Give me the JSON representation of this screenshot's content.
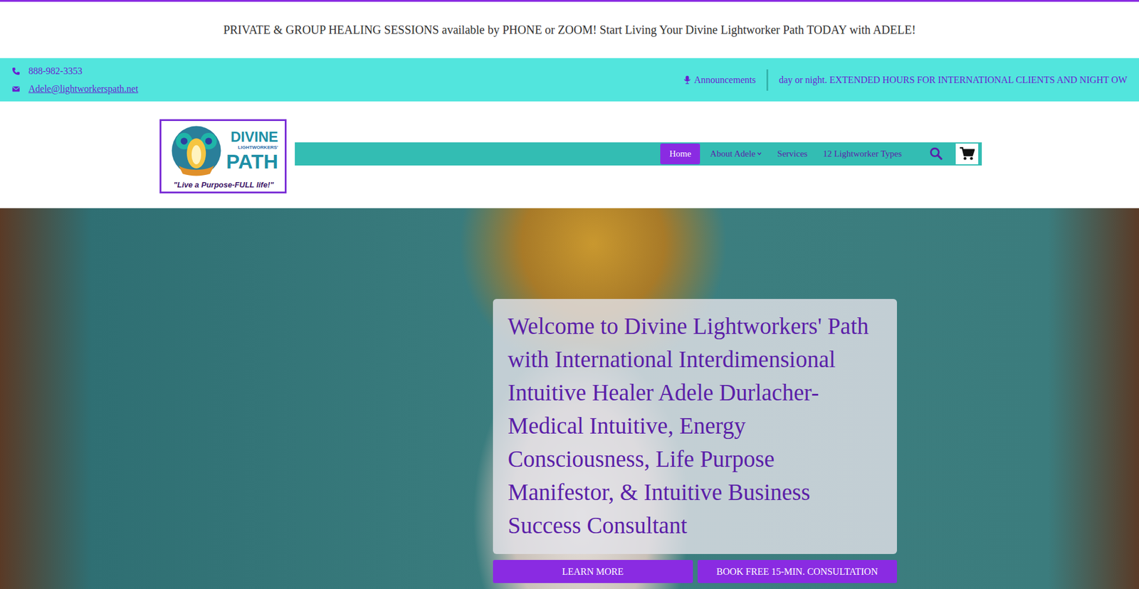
{
  "banner": "PRIVATE & GROUP HEALING SESSIONS available by PHONE or ZOOM! Start Living Your Divine Lightworker Path TODAY with ADELE!",
  "contact": {
    "phone": "888-982-3353",
    "email": "Adele@lightworkerspath.net"
  },
  "announcements": {
    "label": "Announcements",
    "ticker": "day or night. EXTENDED HOURS FOR INTERNATIONAL CLIENTS AND NIGHT OW"
  },
  "logo": {
    "line1": "DIVINE",
    "line2": "LIGHTWORKERS'",
    "line3": "PATH",
    "tagline": "\"Live a Purpose-FULL life!\""
  },
  "nav": [
    {
      "label": "Home",
      "selected": true,
      "dropdown": false
    },
    {
      "label": "About Adele",
      "selected": false,
      "dropdown": true
    },
    {
      "label": "Services",
      "selected": false,
      "dropdown": false
    },
    {
      "label": "12 Lightworker Types",
      "selected": false,
      "dropdown": false
    }
  ],
  "hero": {
    "heading": "Welcome to Divine Lightworkers' Path with International Interdimensional Intuitive Healer Adele Durlacher-Medical Intuitive, Energy Consciousness, Life Purpose Manifestor, & Intuitive Business Success Consultant",
    "buttons": [
      "LEARN MORE",
      "BOOK FREE 15-MIN. CONSULTATION"
    ]
  }
}
